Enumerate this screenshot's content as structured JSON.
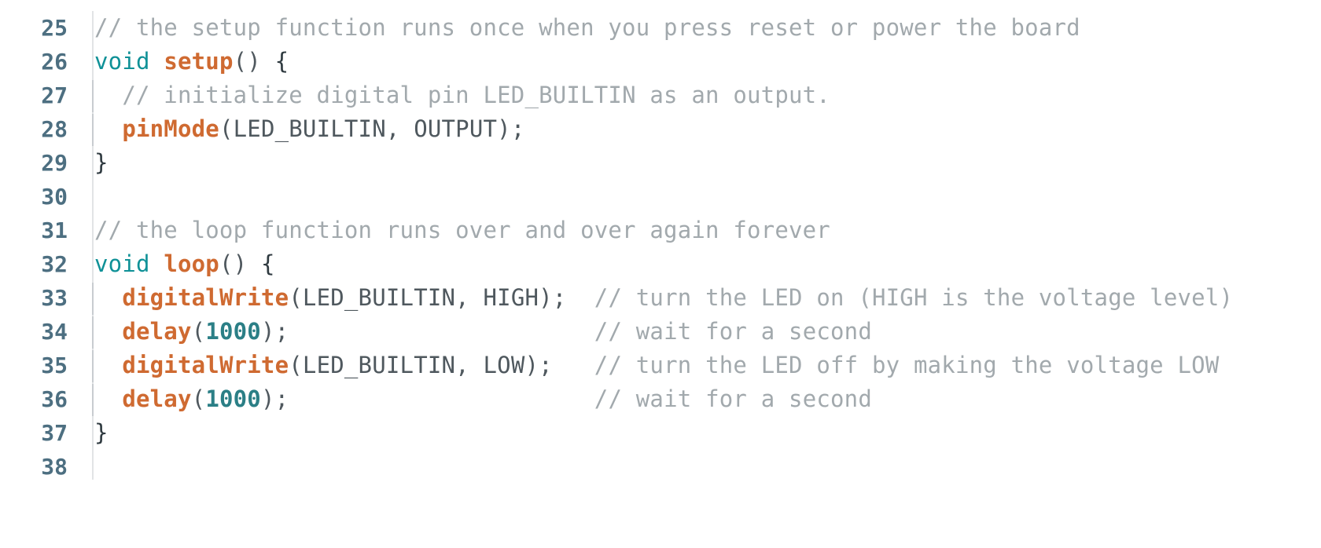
{
  "editor": {
    "name": "arduino-code-editor",
    "language": "C++ / Arduino",
    "background_color": "#ffffff",
    "gutter_color": "#4d6f81",
    "indent_guide_color": "#c8ccd0",
    "colors": {
      "comment": "#a2a9ad",
      "keyword": "#0f9197",
      "function": "#cf6a31",
      "number": "#2b7f86",
      "identifier": "#4f585e",
      "brace": "#2f3a40"
    }
  },
  "lines": [
    {
      "number": "25",
      "indent": false,
      "tokens": [
        {
          "t": "comment",
          "v": "// the setup function runs once when you press reset or power the board"
        }
      ]
    },
    {
      "number": "26",
      "indent": false,
      "tokens": [
        {
          "t": "keyword",
          "v": "void"
        },
        {
          "t": "plain",
          "v": " "
        },
        {
          "t": "func",
          "v": "setup"
        },
        {
          "t": "punct",
          "v": "() "
        },
        {
          "t": "brace",
          "v": "{"
        }
      ]
    },
    {
      "number": "27",
      "indent": true,
      "tokens": [
        {
          "t": "plain",
          "v": "  "
        },
        {
          "t": "comment",
          "v": "// initialize digital pin LED_BUILTIN as an output."
        }
      ]
    },
    {
      "number": "28",
      "indent": true,
      "tokens": [
        {
          "t": "plain",
          "v": "  "
        },
        {
          "t": "func",
          "v": "pinMode"
        },
        {
          "t": "punct",
          "v": "("
        },
        {
          "t": "plain",
          "v": "LED_BUILTIN, OUTPUT"
        },
        {
          "t": "punct",
          "v": ");"
        }
      ]
    },
    {
      "number": "29",
      "indent": false,
      "tokens": [
        {
          "t": "brace",
          "v": "}"
        }
      ]
    },
    {
      "number": "30",
      "indent": false,
      "tokens": []
    },
    {
      "number": "31",
      "indent": false,
      "tokens": [
        {
          "t": "comment",
          "v": "// the loop function runs over and over again forever"
        }
      ]
    },
    {
      "number": "32",
      "indent": false,
      "tokens": [
        {
          "t": "keyword",
          "v": "void"
        },
        {
          "t": "plain",
          "v": " "
        },
        {
          "t": "func",
          "v": "loop"
        },
        {
          "t": "punct",
          "v": "() "
        },
        {
          "t": "brace",
          "v": "{"
        }
      ]
    },
    {
      "number": "33",
      "indent": true,
      "tokens": [
        {
          "t": "plain",
          "v": "  "
        },
        {
          "t": "func",
          "v": "digitalWrite"
        },
        {
          "t": "punct",
          "v": "("
        },
        {
          "t": "plain",
          "v": "LED_BUILTIN, HIGH"
        },
        {
          "t": "punct",
          "v": ");"
        },
        {
          "t": "plain",
          "v": "  "
        },
        {
          "t": "comment",
          "v": "// turn the LED on (HIGH is the voltage level)"
        }
      ]
    },
    {
      "number": "34",
      "indent": true,
      "tokens": [
        {
          "t": "plain",
          "v": "  "
        },
        {
          "t": "func",
          "v": "delay"
        },
        {
          "t": "punct",
          "v": "("
        },
        {
          "t": "number",
          "v": "1000"
        },
        {
          "t": "punct",
          "v": ");"
        },
        {
          "t": "plain",
          "v": "                      "
        },
        {
          "t": "comment",
          "v": "// wait for a second"
        }
      ]
    },
    {
      "number": "35",
      "indent": true,
      "tokens": [
        {
          "t": "plain",
          "v": "  "
        },
        {
          "t": "func",
          "v": "digitalWrite"
        },
        {
          "t": "punct",
          "v": "("
        },
        {
          "t": "plain",
          "v": "LED_BUILTIN, LOW"
        },
        {
          "t": "punct",
          "v": ");"
        },
        {
          "t": "plain",
          "v": "   "
        },
        {
          "t": "comment",
          "v": "// turn the LED off by making the voltage LOW"
        }
      ]
    },
    {
      "number": "36",
      "indent": true,
      "tokens": [
        {
          "t": "plain",
          "v": "  "
        },
        {
          "t": "func",
          "v": "delay"
        },
        {
          "t": "punct",
          "v": "("
        },
        {
          "t": "number",
          "v": "1000"
        },
        {
          "t": "punct",
          "v": ");"
        },
        {
          "t": "plain",
          "v": "                      "
        },
        {
          "t": "comment",
          "v": "// wait for a second"
        }
      ]
    },
    {
      "number": "37",
      "indent": false,
      "tokens": [
        {
          "t": "brace",
          "v": "}"
        }
      ]
    },
    {
      "number": "38",
      "indent": false,
      "tokens": []
    }
  ]
}
